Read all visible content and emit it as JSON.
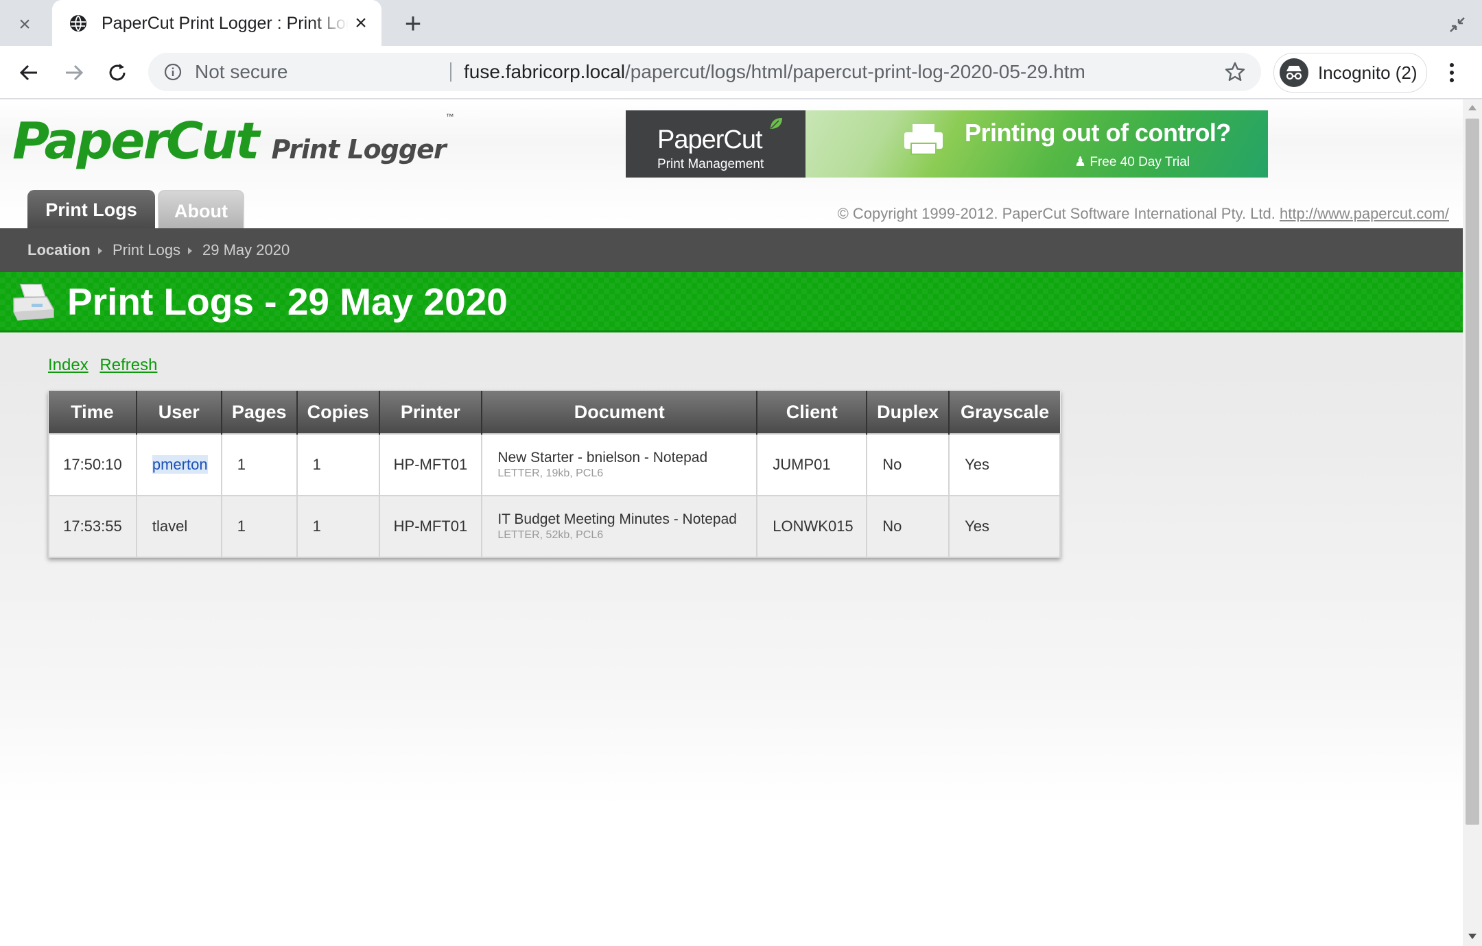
{
  "browser": {
    "tab_title": "PaperCut Print Logger : Print Logs",
    "security_label": "Not secure",
    "url_host": "fuse.fabricorp.local",
    "url_path": "/papercut/logs/html/papercut-print-log-2020-05-29.htm",
    "incognito_label": "Incognito (2)"
  },
  "header": {
    "logo_main": "PaperCut",
    "logo_sub": "Print Logger",
    "logo_tm": "™",
    "banner": {
      "brand": "PaperCut",
      "brand_sub": "Print Management",
      "tagline": "Printing out of control?",
      "trial": "Free 40 Day Trial"
    },
    "nav_tabs": [
      {
        "label": "Print Logs",
        "active": true
      },
      {
        "label": "About",
        "active": false
      }
    ],
    "copyright_text": "© Copyright 1999-2012. PaperCut Software International Pty. Ltd.",
    "copyright_link": "http://www.papercut.com/"
  },
  "breadcrumb": [
    "Location",
    "Print Logs",
    "29 May 2020"
  ],
  "page_title": "Print Logs - 29 May 2020",
  "links": [
    "Index",
    "Refresh"
  ],
  "table": {
    "columns": [
      "Time",
      "User",
      "Pages",
      "Copies",
      "Printer",
      "Document",
      "Client",
      "Duplex",
      "Grayscale"
    ],
    "rows": [
      {
        "time": "17:50:10",
        "user": "pmerton",
        "pages": "1",
        "copies": "1",
        "printer": "HP-MFT01",
        "document": "New Starter - bnielson - Notepad",
        "document_meta": "LETTER, 19kb, PCL6",
        "client": "JUMP01",
        "duplex": "No",
        "grayscale": "Yes"
      },
      {
        "time": "17:53:55",
        "user": "tlavel",
        "pages": "1",
        "copies": "1",
        "printer": "HP-MFT01",
        "document": "IT Budget Meeting Minutes - Notepad",
        "document_meta": "LETTER, 52kb, PCL6",
        "client": "LONWK015",
        "duplex": "No",
        "grayscale": "Yes"
      }
    ]
  },
  "colors": {
    "brand_green": "#0ea70e",
    "breadcrumb_bg": "#4e4e4e",
    "link_green": "#0d9a0d"
  }
}
